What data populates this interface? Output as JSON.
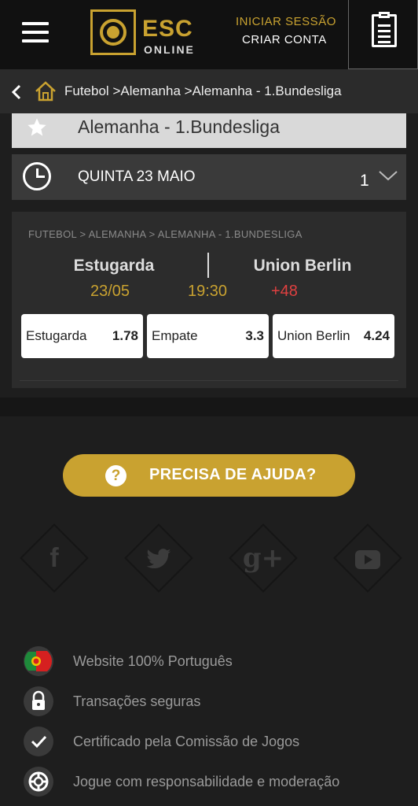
{
  "header": {
    "logo_main": "ESC",
    "logo_sub": "ONLINE",
    "login_label": "INICIAR SESSÃO",
    "register_label": "CRIAR CONTA"
  },
  "breadcrumb": {
    "items": [
      "Futebol",
      ">Alemanha",
      ">Alemanha - 1.Bundesliga"
    ]
  },
  "league": {
    "title": "Alemanha - 1.Bundesliga"
  },
  "date_group": {
    "label": "QUINTA 23 MAIO",
    "count": "1"
  },
  "match": {
    "breadcrumb": "FUTEBOL   > ALEMANHA   > ALEMANHA - 1.BUNDESLIGA",
    "home": "Estugarda",
    "away": "Union Berlin",
    "date": "23/05",
    "time": "19:30",
    "more_markets": "+48",
    "odds": [
      {
        "label": "Estugarda",
        "value": "1.78"
      },
      {
        "label": "Empate",
        "value": "3.3"
      },
      {
        "label": "Union Berlin",
        "value": "4.24"
      }
    ]
  },
  "footer": {
    "help_label": "PRECISA DE AJUDA?",
    "social": [
      "facebook-icon",
      "twitter-icon",
      "google-plus-icon",
      "youtube-icon"
    ],
    "features": [
      {
        "icon": "portugal-flag-icon",
        "text": "Website 100% Português"
      },
      {
        "icon": "lock-icon",
        "text": "Transações seguras"
      },
      {
        "icon": "checkmark-icon",
        "text": "Certificado pela Comissão de Jogos"
      },
      {
        "icon": "lifebuoy-icon",
        "text": "Jogue com responsabilidade e moderação"
      }
    ]
  },
  "colors": {
    "gold": "#c9a230",
    "red": "#e04040",
    "background": "#1e1e1e"
  }
}
